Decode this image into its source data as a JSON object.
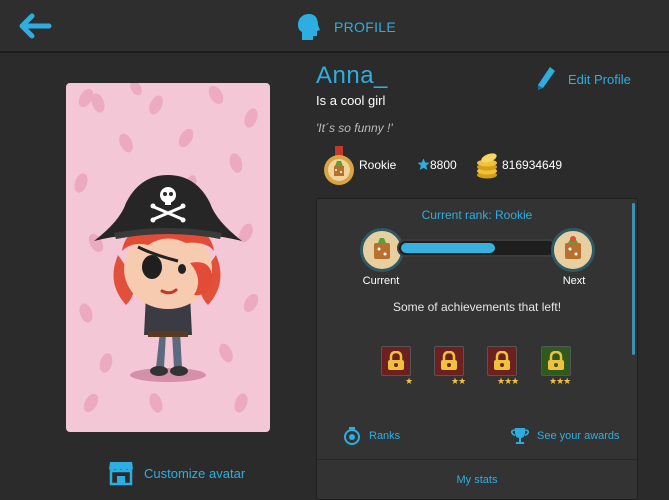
{
  "header": {
    "title": "PROFILE"
  },
  "profile": {
    "username": "Anna_",
    "tagline": "Is a cool girl",
    "quote": "'It´s so funny !'",
    "edit_label": "Edit Profile",
    "customize_label": "Customize avatar"
  },
  "stats": {
    "rank": "Rookie",
    "stars": "8800",
    "coins": "816934649"
  },
  "rank_panel": {
    "title": "Current rank: Rookie",
    "current_label": "Current",
    "next_label": "Next",
    "progress": 0.62,
    "achievements_title": "Some of achievements that left!",
    "achievements": [
      {
        "stars": "★",
        "color": "#6e2020"
      },
      {
        "stars": "★★",
        "color": "#6e2020"
      },
      {
        "stars": "★★★",
        "color": "#6e2020"
      },
      {
        "stars": "★★★",
        "color": "#2f5a1e"
      }
    ],
    "ranks_label": "Ranks",
    "awards_label": "See your awards",
    "my_stats_label": "My stats"
  },
  "colors": {
    "accent": "#2eaee0",
    "card_bg": "#f4c7d7",
    "star": "#f5c23c"
  }
}
